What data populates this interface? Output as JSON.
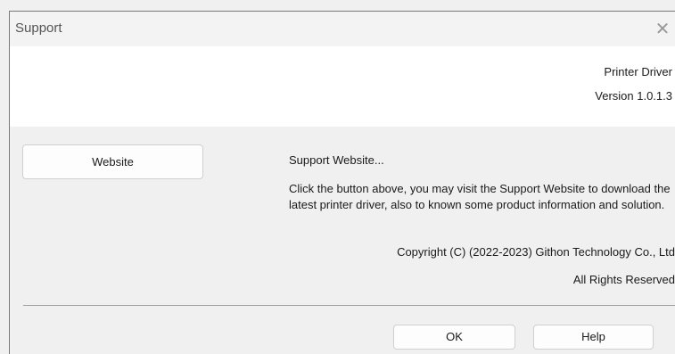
{
  "window": {
    "title": "Support",
    "close_glyph": "✕"
  },
  "header": {
    "product_name": "Printer Driver",
    "version": "Version 1.0.1.3"
  },
  "main": {
    "website_button_label": "Website",
    "support_heading": "Support Website...",
    "support_description": "Click the button above, you may visit the Support Website to download the latest printer driver, also to known some product information and solution.",
    "copyright": "Copyright (C) (2022-2023) Githon Technology Co., Ltd",
    "rights": "All Rights Reserved"
  },
  "footer": {
    "ok_label": "OK",
    "help_label": "Help"
  }
}
